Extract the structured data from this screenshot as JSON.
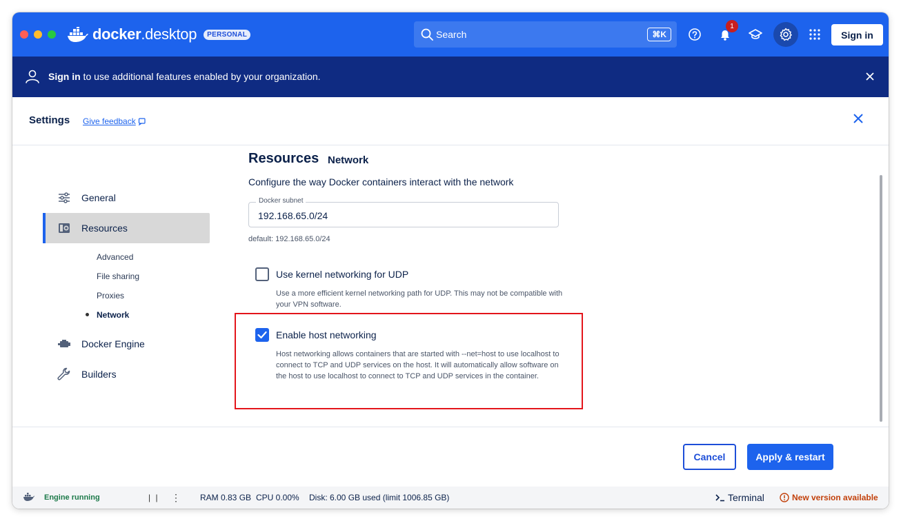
{
  "app": {
    "logo_prefix": "docker",
    "logo_suffix": "desktop",
    "edition_badge": "PERSONAL",
    "search_placeholder": "Search",
    "search_shortcut": "⌘K",
    "notification_count": "1",
    "sign_in_label": "Sign in"
  },
  "banner": {
    "sign_in_link": "Sign in",
    "message": " to use additional features enabled by your organization."
  },
  "settings": {
    "title": "Settings",
    "feedback_link": "Give feedback"
  },
  "sidebar": {
    "items": [
      {
        "label": "General",
        "icon": "sliders-icon"
      },
      {
        "label": "Resources",
        "icon": "resources-icon",
        "active": true
      },
      {
        "label": "Docker Engine",
        "icon": "engine-icon"
      },
      {
        "label": "Builders",
        "icon": "wrench-icon"
      }
    ],
    "subitems": [
      {
        "label": "Advanced"
      },
      {
        "label": "File sharing"
      },
      {
        "label": "Proxies"
      },
      {
        "label": "Network",
        "active": true
      }
    ]
  },
  "main": {
    "section_title": "Resources",
    "section_sub": "Network",
    "description": "Configure the way Docker containers interact with the network",
    "subnet": {
      "label": "Docker subnet",
      "value": "192.168.65.0/24",
      "help": "default: 192.168.65.0/24"
    },
    "options": [
      {
        "label": "Use kernel networking for UDP",
        "checked": false,
        "help": "Use a more efficient kernel networking path for UDP. This may not be compatible with your VPN software."
      },
      {
        "label": "Enable host networking",
        "checked": true,
        "help": "Host networking allows containers that are started with --net=host to use localhost to connect to TCP and UDP services on the host. It will automatically allow software on the host to use localhost to connect to TCP and UDP services in the container."
      }
    ]
  },
  "footer": {
    "cancel_label": "Cancel",
    "apply_label": "Apply & restart"
  },
  "statusbar": {
    "engine_status": "Engine running",
    "pause_glyph": "| |",
    "menu_glyph": "⋮",
    "ram": "RAM 0.83 GB",
    "cpu": "CPU 0.00%",
    "disk": "Disk: 6.00 GB used (limit 1006.85 GB)",
    "terminal_label": "Terminal",
    "new_version": "New version available"
  },
  "colors": {
    "titlebar": "#1d63ed",
    "banner": "#0f2b82",
    "accent": "#1d63ed",
    "highlight": "#e3141a"
  }
}
